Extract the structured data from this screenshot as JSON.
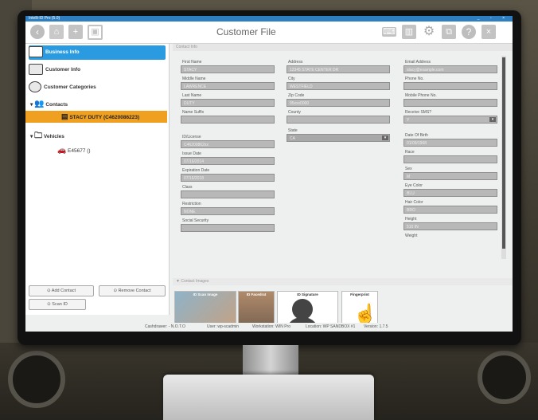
{
  "window": {
    "title": "Intelli-ID Pro (5.0)",
    "controls": "_ ▫ ×"
  },
  "toolbar": {
    "title": "Customer File",
    "left_icons": [
      "back-icon",
      "home-icon",
      "add-icon",
      "save-icon"
    ],
    "right_icons": [
      "keyboard-icon",
      "barcode-icon",
      "settings-icon",
      "scan-icon",
      "help-icon",
      "close-icon"
    ]
  },
  "sidebar": {
    "nav": [
      {
        "label": "Business Info",
        "icon": "business-icon",
        "selected": true
      },
      {
        "label": "Customer Info",
        "icon": "customer-icon",
        "selected": false
      },
      {
        "label": "Customer Categories",
        "icon": "categories-icon",
        "selected": false
      }
    ],
    "contacts_label": "Contacts",
    "contact_selected": "STACY DUTY (C4620086223)",
    "vehicles_label": "Vehicles",
    "vehicle_item": "E45677 ()",
    "add_contact": "Add Contact",
    "remove_contact": "Remove Contact",
    "scan_id": "Scan ID"
  },
  "form": {
    "section_contact": "Contact Info",
    "section_images": "▼ Contact Images",
    "col1": [
      {
        "label": "First Name",
        "value": "STACY"
      },
      {
        "label": "Middle Name",
        "value": "LAWRENCE"
      },
      {
        "label": "Last Name",
        "value": "DUTY"
      },
      {
        "label": "Name Suffix",
        "value": ""
      },
      {
        "label": "ID/License",
        "value": "C46200862xx"
      },
      {
        "label": "Issue Date",
        "value": "07/16/2014"
      },
      {
        "label": "Expiration Date",
        "value": "07/16/2018"
      },
      {
        "label": "Class",
        "value": ""
      },
      {
        "label": "Restriction",
        "value": "NONE"
      },
      {
        "label": "Social Security",
        "value": ""
      }
    ],
    "col2": [
      {
        "label": "Address",
        "value": "12345 STATE CENTER DR"
      },
      {
        "label": "City",
        "value": "WESTFIELD"
      },
      {
        "label": "Zip Code",
        "value": "95xxx0000"
      },
      {
        "label": "County",
        "value": ""
      },
      {
        "label": "State",
        "value": "CA"
      }
    ],
    "col3": [
      {
        "label": "Email Address",
        "value": "stacy@example.com"
      },
      {
        "label": "Phone No.",
        "value": ""
      },
      {
        "label": "Mobile Phone No.",
        "value": ""
      },
      {
        "label": "Receive SMS?",
        "value": "Y"
      },
      {
        "label": "Date Of Birth",
        "value": "01/09/1968"
      },
      {
        "label": "Race",
        "value": ""
      },
      {
        "label": "Sex",
        "value": "M"
      },
      {
        "label": "Eye Color",
        "value": "BLU"
      },
      {
        "label": "Hair Color",
        "value": "BRO"
      },
      {
        "label": "Height",
        "value": "510 IN"
      },
      {
        "label": "Weight",
        "value": ""
      }
    ],
    "images": [
      {
        "caption": "ID Scan Image",
        "icon": "id-scan-image"
      },
      {
        "caption": "ID Facedrat",
        "icon": "id-face-photo"
      },
      {
        "caption": "ID Signature",
        "icon": "signature-icon"
      },
      {
        "caption": "Fingerprint",
        "icon": "fingerprint-icon"
      }
    ]
  },
  "status": {
    "cashdrawer": "Cashdrawer: - N.O.T.O",
    "user": "User: wp-scadmin",
    "workstation": "Workstation: WIN Pro",
    "location": "Location: WP SANDBOX #1",
    "version": "Version: 1.7.5"
  },
  "colors": {
    "accent": "#2a9be0",
    "selected_contact": "#f0a020",
    "titlebar": "#2d7fc1"
  }
}
